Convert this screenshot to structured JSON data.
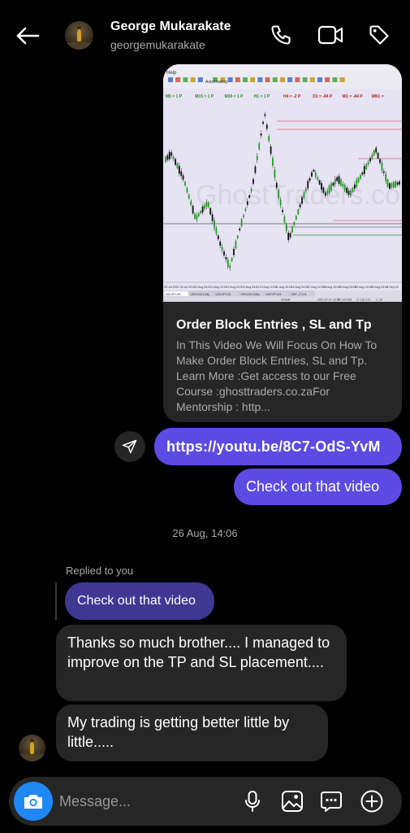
{
  "header": {
    "contact_name": "George Mukarakate",
    "contact_username": "georgemukarakate",
    "icons": [
      "back-arrow-icon",
      "phone-icon",
      "video-icon",
      "tag-icon"
    ]
  },
  "link_preview": {
    "title": "Order Block Entries , SL and Tp",
    "description": "In This Video We Will Focus On How To Make Order Block Entries, SL and Tp. Learn More :Get access to our Free Course :ghosttraders.co.zaFor Mentorship : http...",
    "thumbnail": {
      "menu_label": "Help",
      "toolbar_label": "AutoTrading",
      "timeframe_labels": [
        "M5 = 1 P",
        "M15 = 1 P",
        "M30 = 1 P",
        "H1 = 1 P",
        "H4 = -2 P",
        "D1 = -84 P",
        "W1 = -84 P",
        "MN1 ="
      ],
      "watermark": "GhostTraders.co.za",
      "date_labels": [
        "28 Jul 2021",
        "30 Jul 20:00",
        "3 Aug 04:00",
        "4 Aug 12:00",
        "5 Aug 20:00",
        "9 Aug 04:00",
        "10 Aug 12:00",
        "11 Aug 20:00",
        "16 Aug 04:00",
        "17 Aug 12:00",
        "18 Aug 20:00",
        "20 Aug 04:00",
        "23 Aug 12:00",
        "25 Aug 04:00",
        "3 Sep 04"
      ],
      "tabs": [
        "USDJPY,H4",
        "USDCAD,Daily",
        "USDJPY,H4",
        "VRVUSD,Daily",
        "GBPJPY,H4",
        "GBP_CT,H1"
      ],
      "status_items": [
        "Default",
        "2021.07.27 12:00",
        "O: 110.081",
        "H: 110.173",
        "L: 10"
      ],
      "colors": {
        "bull": "#1aa31a",
        "bear": "#111111",
        "level": "#e06070",
        "background": "#e6e3f3"
      }
    }
  },
  "messages": {
    "url": "https://youtu.be/8C7-OdS-YvM",
    "sent_text": "Check out that video",
    "timestamp": "26 Aug, 14:06",
    "replied_label": "Replied to you",
    "reply_quote": "Check out that video",
    "received_1": "Thanks so much brother.... I managed to improve on the  TP and SL placement....",
    "received_2": "My trading is getting better little by little....."
  },
  "composer": {
    "placeholder": "Message...",
    "icons": [
      "camera-icon",
      "microphone-icon",
      "image-icon",
      "sticker-icon",
      "plus-circle-icon"
    ]
  },
  "theme": {
    "outgoing_bubble": "#5b4be3",
    "reply_bubble": "#3e3893",
    "incoming_bubble": "#262626",
    "camera_button": "#1e88f5"
  }
}
